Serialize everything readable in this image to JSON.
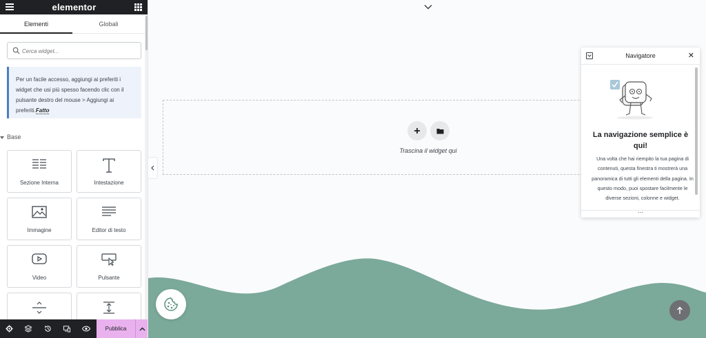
{
  "app": {
    "logo": "elementor"
  },
  "sidebar": {
    "tabs": [
      {
        "label": "Elementi"
      },
      {
        "label": "Globali"
      }
    ],
    "search": {
      "placeholder": "Cerca widget..."
    },
    "tip": {
      "text": "Per un facile accesso, aggiungi ai preferiti i widget che usi più spesso facendo clic con il pulsante destro del mouse > Aggiungi ai preferiti.",
      "done_link": "Fatto"
    },
    "category": "Base",
    "widgets": [
      {
        "label": "Sezione Interna",
        "icon": "inner-section-icon"
      },
      {
        "label": "Intestazione",
        "icon": "heading-icon"
      },
      {
        "label": "Immagine",
        "icon": "image-icon"
      },
      {
        "label": "Editor di testo",
        "icon": "text-editor-icon"
      },
      {
        "label": "Video",
        "icon": "video-icon"
      },
      {
        "label": "Pulsante",
        "icon": "button-icon"
      },
      {
        "label": "",
        "icon": "divider-icon"
      },
      {
        "label": "",
        "icon": "spacer-icon"
      }
    ],
    "footer": {
      "icons": [
        "settings-icon",
        "navigator-layers-icon",
        "history-icon",
        "responsive-mode-icon",
        "preview-eye-icon"
      ],
      "publish_label": "Pubblica"
    }
  },
  "canvas": {
    "dropzone_text": "Trascina il widget qui",
    "wave_color": "#7ba99a",
    "accent_color": "#e9b1ee"
  },
  "navigator": {
    "title": "Navigatore",
    "heading": "La navigazione semplice è qui!",
    "description": "Una volta che hai riempito la tua pagina di contenuti, questa finestra ti mostrerà una panoramica di tutti gli elementi della pagina. In questo modo, puoi spostare facilmente le diverse sezioni, colonne e widget."
  }
}
